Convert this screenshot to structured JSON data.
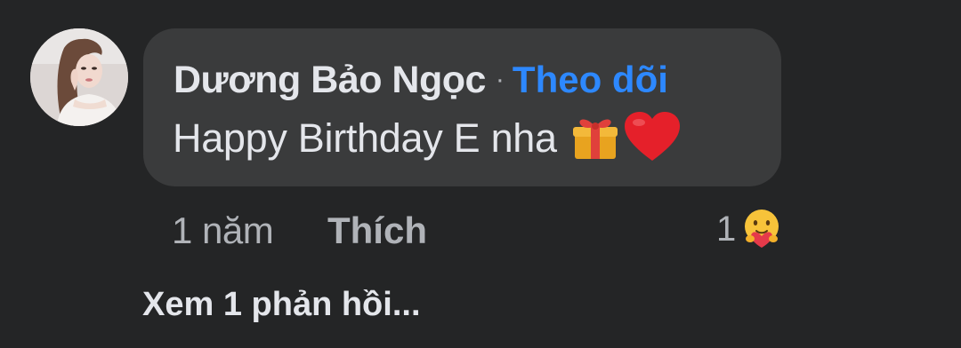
{
  "comment": {
    "author": "Dương Bảo Ngọc",
    "separator": "·",
    "follow_label": "Theo dõi",
    "text": "Happy Birthday E nha",
    "emojis": [
      "gift-emoji",
      "red-heart-emoji"
    ]
  },
  "actions": {
    "time": "1 năm",
    "like_label": "Thích",
    "reaction_count": "1",
    "reaction_type": "care-reaction-icon"
  },
  "replies": {
    "view_label": "Xem 1 phản hồi..."
  },
  "colors": {
    "background": "#242526",
    "bubble": "#3a3b3c",
    "primary_text": "#e4e6eb",
    "secondary_text": "#b0b3b8",
    "link": "#2d88ff"
  }
}
